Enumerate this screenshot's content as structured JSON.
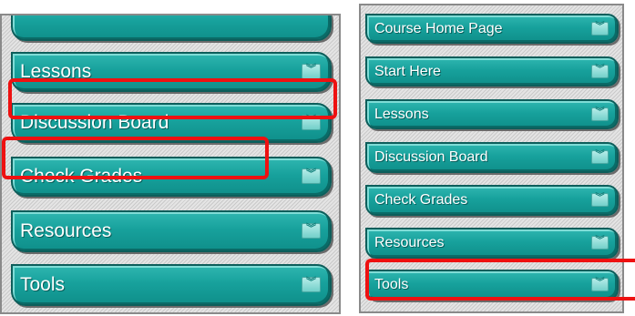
{
  "left_panel": {
    "items": [
      {
        "label": ""
      },
      {
        "label": "Lessons",
        "icon": "chevron-down-icon"
      },
      {
        "label": "Discussion Board",
        "icon": "chevron-down-icon"
      },
      {
        "label": "Check Grades",
        "icon": "chevron-down-icon"
      },
      {
        "label": "Resources",
        "icon": "chevron-down-icon"
      },
      {
        "label": "Tools",
        "icon": "chevron-down-icon"
      }
    ]
  },
  "right_panel": {
    "items": [
      {
        "label": "Course Home Page",
        "icon": "chevron-down-icon"
      },
      {
        "label": "Start Here",
        "icon": "chevron-down-icon"
      },
      {
        "label": "Lessons",
        "icon": "chevron-down-icon"
      },
      {
        "label": "Discussion Board",
        "icon": "chevron-down-icon"
      },
      {
        "label": "Check Grades",
        "icon": "chevron-down-icon"
      },
      {
        "label": "Resources",
        "icon": "chevron-down-icon"
      },
      {
        "label": "Tools",
        "icon": "chevron-down-icon"
      }
    ]
  },
  "colors": {
    "menu_teal": "#17a19c",
    "menu_border": "#0d5e5b",
    "highlight_red": "#ee1111",
    "panel_gray": "#d9d9d9"
  }
}
